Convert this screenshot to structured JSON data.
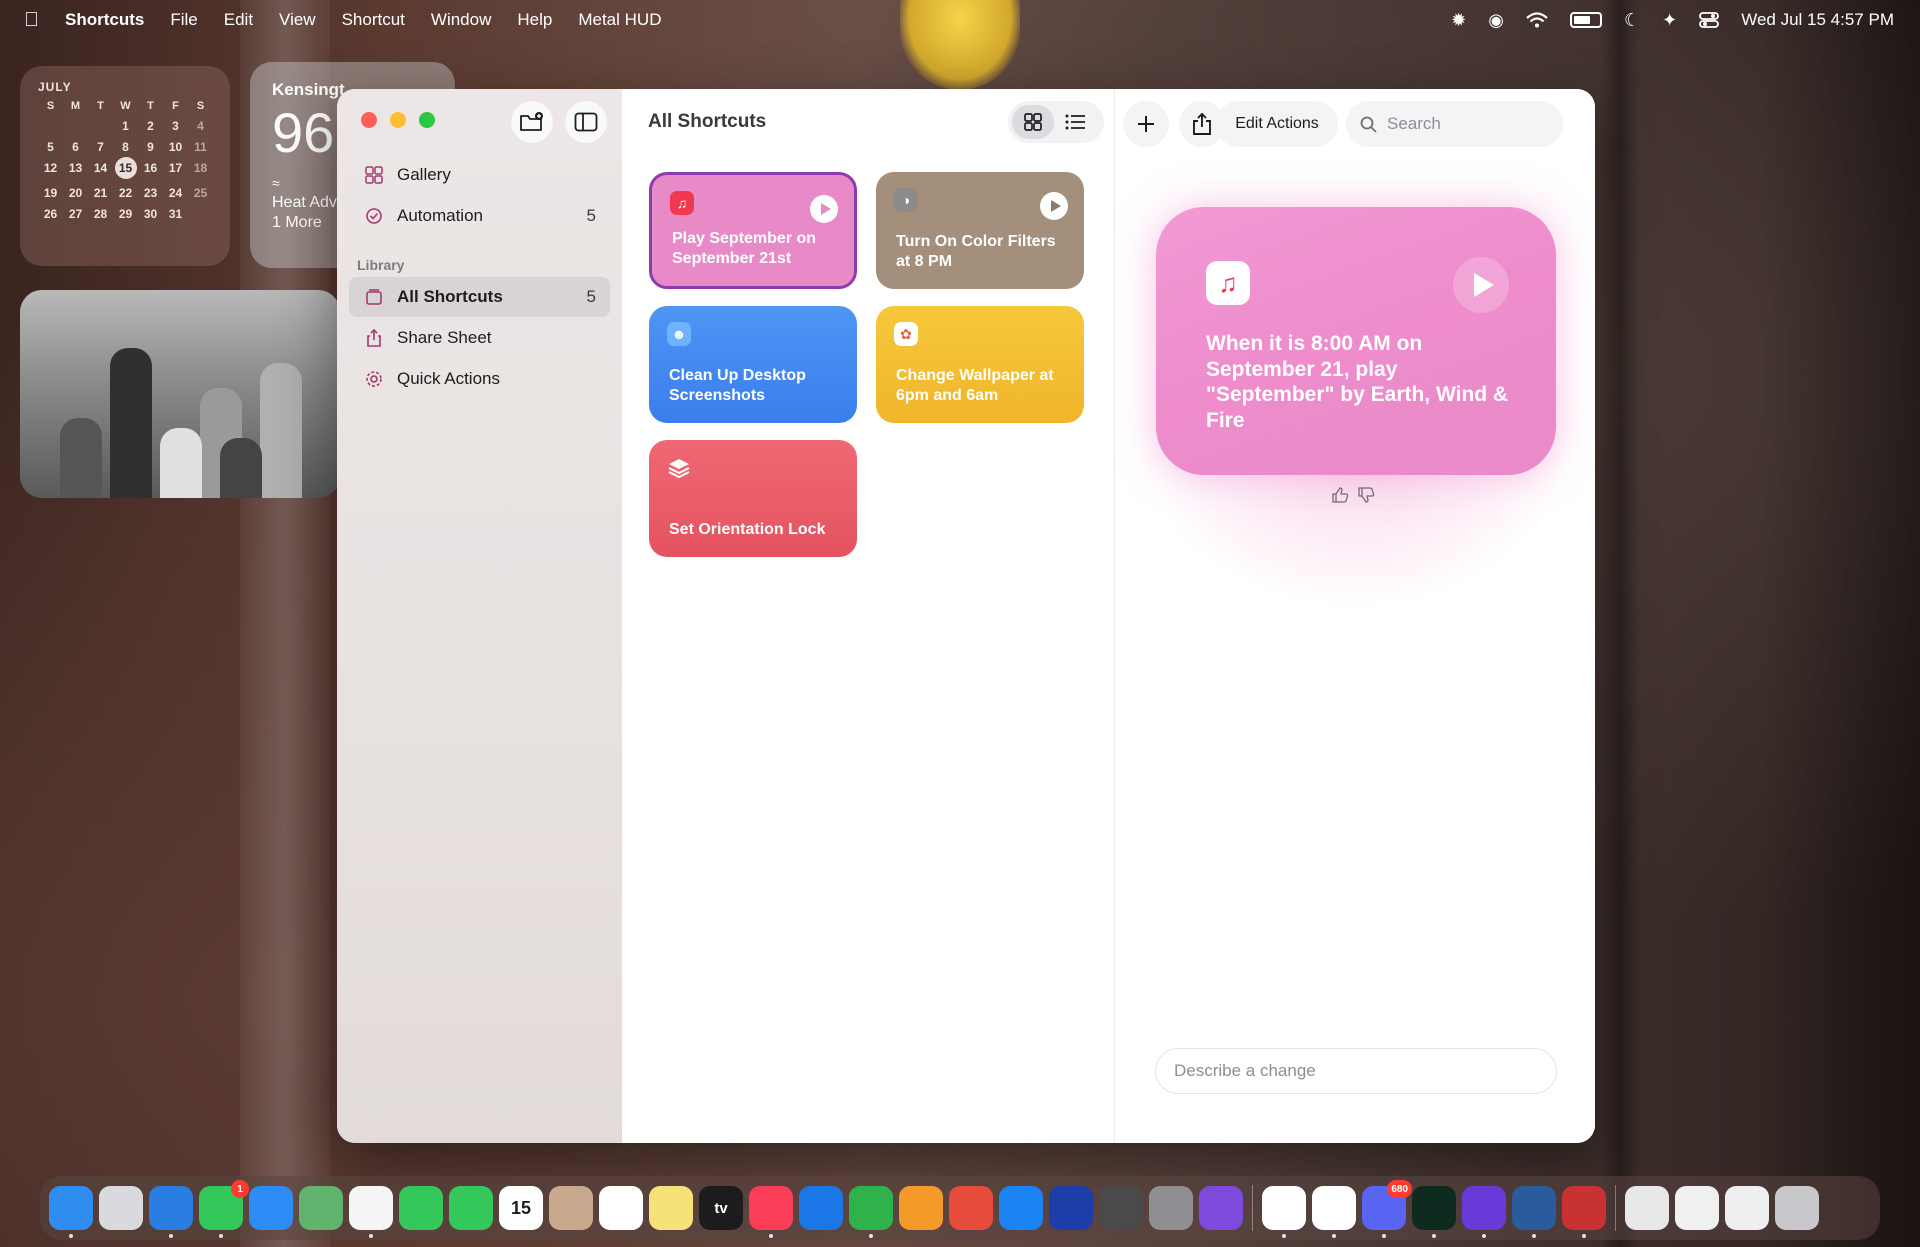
{
  "menubar": {
    "app_name": "Shortcuts",
    "menus": [
      "File",
      "Edit",
      "View",
      "Shortcut",
      "Window",
      "Help",
      "Metal HUD"
    ],
    "clock": "Wed Jul 15  4:57 PM"
  },
  "widgets": {
    "calendar": {
      "month": "JULY",
      "weekdays": [
        "S",
        "M",
        "T",
        "W",
        "T",
        "F",
        "S"
      ],
      "days": [
        "",
        "",
        "",
        "1",
        "2",
        "3",
        "4",
        "5",
        "6",
        "7",
        "8",
        "9",
        "10",
        "11",
        "12",
        "13",
        "14",
        "15",
        "16",
        "17",
        "18",
        "19",
        "20",
        "21",
        "22",
        "23",
        "24",
        "25",
        "26",
        "27",
        "28",
        "29",
        "30",
        "31"
      ],
      "today": "15"
    },
    "weather": {
      "city": "Kensingt",
      "temp": "96",
      "alert_line1": "Heat Adv",
      "alert_line2": "1 More"
    }
  },
  "sidebar": {
    "items": [
      {
        "label": "Gallery",
        "count": "",
        "icon": "gallery-icon"
      },
      {
        "label": "Automation",
        "count": "5",
        "icon": "automation-icon"
      }
    ],
    "library_header": "Library",
    "library": [
      {
        "label": "All Shortcuts",
        "count": "5",
        "icon": "all-shortcuts-icon",
        "active": true
      },
      {
        "label": "Share Sheet",
        "count": "",
        "icon": "share-sheet-icon"
      },
      {
        "label": "Quick Actions",
        "count": "",
        "icon": "gear-icon"
      }
    ]
  },
  "content": {
    "title": "All Shortcuts",
    "shortcuts": [
      {
        "title": "Play September on September 21st",
        "color": "#e98ac8",
        "icon": "music-icon",
        "selected": true
      },
      {
        "title": "Turn On Color Filters at 8 PM",
        "color": "#a48f7c",
        "icon": "color-filter-icon"
      },
      {
        "title": "Clean Up Desktop Screenshots",
        "color": "#3d86ef",
        "icon": "finder-icon"
      },
      {
        "title": "Change Wallpaper at 6pm and 6am",
        "color": "#f3c130",
        "icon": "photos-icon"
      },
      {
        "title": "Set Orientation Lock",
        "color": "#e85b68",
        "icon": "layers-icon"
      }
    ]
  },
  "detail": {
    "edit_actions_label": "Edit Actions",
    "search_placeholder": "Search",
    "card_text": "When it is 8:00 AM on September 21, play \"September\" by Earth, Wind & Fire",
    "describe_placeholder": "Describe a change"
  },
  "dock": {
    "apps": [
      "Finder",
      "Launchpad",
      "Safari",
      "Messages",
      "Mail",
      "Maps",
      "Photos",
      "FaceTime",
      "Phone",
      "Calendar",
      "Contacts",
      "Reminders",
      "Notes",
      "TV",
      "Music",
      "Keynote",
      "Numbers",
      "Pages",
      "Rocket",
      "App Store",
      "Mirror",
      "Help",
      "System Settings",
      "Feedback",
      "Chrome",
      "Slack",
      "Discord",
      "ChatGPT",
      "Shortcuts",
      "Robot",
      "Parallels",
      "Documents",
      "Preview",
      "Files",
      "Trash"
    ],
    "messages_badge": "1",
    "discord_badge": "680",
    "calendar_date": "15",
    "tv_label": "tv"
  }
}
